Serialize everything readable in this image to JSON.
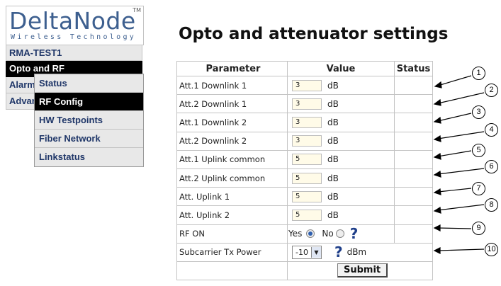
{
  "logo": {
    "name": "DeltaNode",
    "tagline": "Wireless  Technology",
    "tm": "TM"
  },
  "nav": {
    "items": [
      {
        "label": "RMA-TEST1",
        "active": false
      },
      {
        "label": "Opto and RF",
        "active": true
      },
      {
        "label": "Alarm",
        "active": false
      },
      {
        "label": "Advanced",
        "active": false
      }
    ],
    "submenu": [
      {
        "label": "Status",
        "active": false
      },
      {
        "label": "RF Config",
        "active": true
      },
      {
        "label": "HW Testpoints",
        "active": false
      },
      {
        "label": "Fiber Network",
        "active": false
      },
      {
        "label": "Linkstatus",
        "active": false
      }
    ]
  },
  "page_title": "Opto and attenuator settings",
  "table": {
    "headers": [
      "Parameter",
      "Value",
      "Status"
    ],
    "attenuators": [
      {
        "label": "Att.1 Downlink 1",
        "value": "3",
        "unit": "dB"
      },
      {
        "label": "Att.2 Downlink 1",
        "value": "3",
        "unit": "dB"
      },
      {
        "label": "Att.1 Downlink 2",
        "value": "3",
        "unit": "dB"
      },
      {
        "label": "Att.2 Downlink 2",
        "value": "3",
        "unit": "dB"
      },
      {
        "label": "Att.1 Uplink common",
        "value": "5",
        "unit": "dB"
      },
      {
        "label": "Att.2 Uplink common",
        "value": "5",
        "unit": "dB"
      },
      {
        "label": "Att. Uplink 1",
        "value": "5",
        "unit": "dB"
      },
      {
        "label": "Att. Uplink 2",
        "value": "5",
        "unit": "dB"
      }
    ],
    "rf_on": {
      "label": "RF ON",
      "yes": "Yes",
      "no": "No",
      "selected": "Yes",
      "help": "?"
    },
    "tx_power": {
      "label": "Subcarrier Tx Power",
      "value": "-10",
      "unit": "dBm",
      "help": "?"
    },
    "submit": "Submit"
  },
  "callouts": [
    "1",
    "2",
    "3",
    "4",
    "5",
    "6",
    "7",
    "8",
    "9",
    "10"
  ],
  "colors": {
    "brand": "#3d5f8f",
    "nav_text": "#1f3668",
    "active_bg": "#000000",
    "input_bg": "#fffbe8"
  }
}
